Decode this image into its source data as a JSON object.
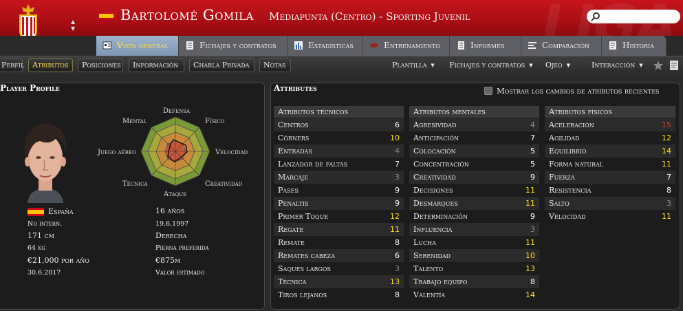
{
  "header": {
    "watermark": "LIGA",
    "player_name": "Bartolomé Gomila",
    "position_club": "Mediapunta (Centro) - Sporting Juvenil",
    "search_placeholder": ""
  },
  "tabs": [
    {
      "label": "Vista general",
      "active": true
    },
    {
      "label": "Fichajes y contratos"
    },
    {
      "label": "Estadísticas"
    },
    {
      "label": "Entrenamiento"
    },
    {
      "label": "Informes"
    },
    {
      "label": "Comparación"
    },
    {
      "label": "Historia"
    }
  ],
  "subnav": {
    "buttons": [
      {
        "label": "Perfil"
      },
      {
        "label": "Atributos",
        "active": true
      },
      {
        "label": "Posiciones"
      },
      {
        "label": "Información"
      },
      {
        "label": "Charla Privada"
      },
      {
        "label": "Notas"
      }
    ],
    "dropdowns": [
      "Plantilla",
      "Fichajes y contratos",
      "Ojeo",
      "Interacción"
    ]
  },
  "profile": {
    "title": "Player Profile",
    "radar_labels": {
      "defensa": "Defensa",
      "fisico": "Físico",
      "velocidad": "Velocidad",
      "creatividad": "Creatividad",
      "ataque": "Ataque",
      "tecnica": "Técnica",
      "juego_aereo": "Juego aéreo",
      "mental": "Mental"
    },
    "nationality": "España",
    "intl": "No intern.",
    "height": "171 cm",
    "weight": "64 kg",
    "wage": "€21,000 por año",
    "contract_end": "30.6.2017",
    "age": "16 años",
    "dob": "19.6.1997",
    "foot": "Derecha",
    "foot_label": "Pierna preferida",
    "value": "€875m",
    "value_label": "Valor estimado"
  },
  "attributes": {
    "title": "Attributes",
    "show_changes_label": "Mostrar los cambios de atributos recientes",
    "show_changes_checked": false,
    "columns": [
      {
        "title": "Atributos técnicos",
        "rows": [
          {
            "name": "Centros",
            "value": "6"
          },
          {
            "name": "Córners",
            "value": "10"
          },
          {
            "name": "Entradas",
            "value": "4"
          },
          {
            "name": "Lanzador de faltas",
            "value": "7"
          },
          {
            "name": "Marcaje",
            "value": "3"
          },
          {
            "name": "Pases",
            "value": "9"
          },
          {
            "name": "Penaltis",
            "value": "9"
          },
          {
            "name": "Primer Toque",
            "value": "12"
          },
          {
            "name": "Regate",
            "value": "11"
          },
          {
            "name": "Remate",
            "value": "8"
          },
          {
            "name": "Remates cabeza",
            "value": "6"
          },
          {
            "name": "Saques largos",
            "value": "3"
          },
          {
            "name": "Técnica",
            "value": "13"
          },
          {
            "name": "Tiros lejanos",
            "value": "8"
          }
        ]
      },
      {
        "title": "Atributos mentales",
        "rows": [
          {
            "name": "Agresividad",
            "value": "4"
          },
          {
            "name": "Anticipación",
            "value": "7"
          },
          {
            "name": "Colocación",
            "value": "5"
          },
          {
            "name": "Concentración",
            "value": "5"
          },
          {
            "name": "Creatividad",
            "value": "9"
          },
          {
            "name": "Decisiones",
            "value": "11"
          },
          {
            "name": "Desmarques",
            "value": "11"
          },
          {
            "name": "Determinación",
            "value": "9"
          },
          {
            "name": "Influencia",
            "value": "3"
          },
          {
            "name": "Lucha",
            "value": "11"
          },
          {
            "name": "Serenidad",
            "value": "10"
          },
          {
            "name": "Talento",
            "value": "13"
          },
          {
            "name": "Trabajo equipo",
            "value": "8"
          },
          {
            "name": "Valentía",
            "value": "14"
          }
        ]
      },
      {
        "title": "Atributos físicos",
        "rows": [
          {
            "name": "Aceleración",
            "value": "15"
          },
          {
            "name": "Agilidad",
            "value": "12"
          },
          {
            "name": "Equilibrio",
            "value": "14"
          },
          {
            "name": "Forma natural",
            "value": "11"
          },
          {
            "name": "Fuerza",
            "value": "7"
          },
          {
            "name": "Resistencia",
            "value": "8"
          },
          {
            "name": "Salto",
            "value": "3"
          },
          {
            "name": "Velocidad",
            "value": "11"
          }
        ]
      }
    ]
  },
  "colors": {
    "header_red": "#b01018",
    "active_tab_text": "#ffe14d",
    "value_low": "#8a8a8a",
    "value_normal": "#ffffff",
    "value_good": "#ffe020",
    "value_high": "#e23a2a"
  }
}
